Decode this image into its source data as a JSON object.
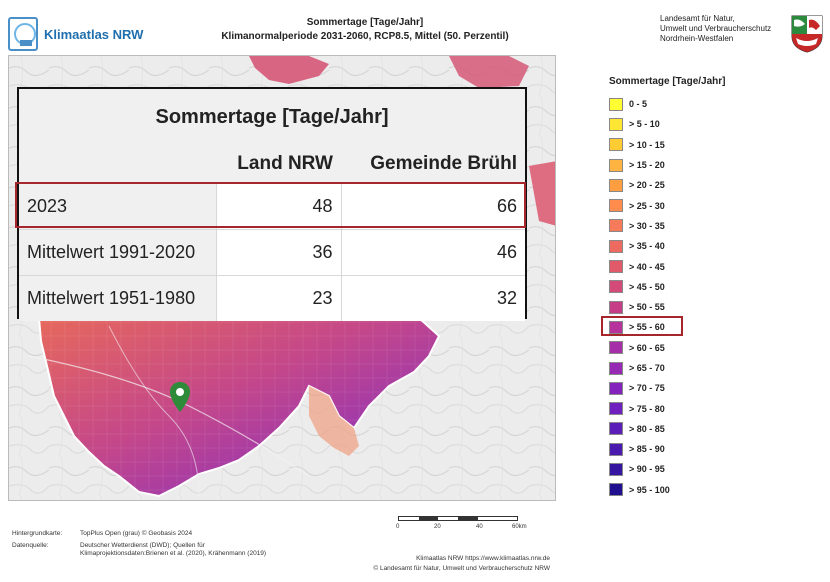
{
  "header": {
    "logo_text": "Klimaatlas NRW",
    "title_line1": "Sommertage [Tage/Jahr]",
    "title_line2": "Klimanormalperiode 2031-2060, RCP8.5, Mittel (50. Perzentil)",
    "agency_lines": [
      "Landesamt für Natur,",
      "Umwelt und Verbraucherschutz",
      "Nordrhein-Westfalen"
    ]
  },
  "table": {
    "title": "Sommertage [Tage/Jahr]",
    "columns": [
      "",
      "Land NRW",
      "Gemeinde Brühl"
    ],
    "rows": [
      {
        "label": "2023",
        "land": "48",
        "gemeinde": "66"
      },
      {
        "label": "Mittelwert 1991-2020",
        "land": "36",
        "gemeinde": "46"
      },
      {
        "label": "Mittelwert 1951-1980",
        "land": "23",
        "gemeinde": "32"
      }
    ]
  },
  "legend": {
    "title": "Sommertage [Tage/Jahr]",
    "items": [
      {
        "label": "0 - 5",
        "color": "#ffff33"
      },
      {
        "label": "> 5 - 10",
        "color": "#ffe633"
      },
      {
        "label": "> 10 - 15",
        "color": "#ffcc33"
      },
      {
        "label": "> 15 - 20",
        "color": "#ffb340"
      },
      {
        "label": "> 20 - 25",
        "color": "#ff9e40"
      },
      {
        "label": "> 25 - 30",
        "color": "#ff8c4d"
      },
      {
        "label": "> 30 - 35",
        "color": "#f77a5a"
      },
      {
        "label": "> 35 - 40",
        "color": "#ec6a60"
      },
      {
        "label": "> 40 - 45",
        "color": "#e05a6a"
      },
      {
        "label": "> 45 - 50",
        "color": "#d44a78"
      },
      {
        "label": "> 50 - 55",
        "color": "#c43d86"
      },
      {
        "label": "> 55 - 60",
        "color": "#b5339a"
      },
      {
        "label": "> 60 - 65",
        "color": "#a62ea8"
      },
      {
        "label": "> 65 - 70",
        "color": "#962ab4"
      },
      {
        "label": "> 70 - 75",
        "color": "#8322bc"
      },
      {
        "label": "> 75 - 80",
        "color": "#7020be"
      },
      {
        "label": "> 80 - 85",
        "color": "#5c1eb8"
      },
      {
        "label": "> 85 - 90",
        "color": "#4a1aae"
      },
      {
        "label": "> 90 - 95",
        "color": "#3616a0"
      },
      {
        "label": "> 95 - 100",
        "color": "#201090"
      }
    ],
    "highlighted": "> 55 - 60"
  },
  "marker": {
    "icon": "location-pin-icon",
    "color": "#2e8b3a"
  },
  "scalebar": {
    "ticks": [
      "0",
      "20",
      "40",
      "60km"
    ]
  },
  "footer": {
    "basemap_label": "Hintergrundkarte:",
    "basemap_value": "TopPlus Open (grau) © Geobasis 2024",
    "source_label": "Datenquelle:",
    "source_value": "Deutscher Wetterdienst (DWD); Quellen für Klimaprojektionsdaten:Brienen et al. (2020), Krähenmann (2019)",
    "website": "Klimaatlas NRW https://www.klimaatlas.nrw.de",
    "copyright": "© Landesamt für Natur, Umwelt und Verbraucherschutz NRW"
  }
}
